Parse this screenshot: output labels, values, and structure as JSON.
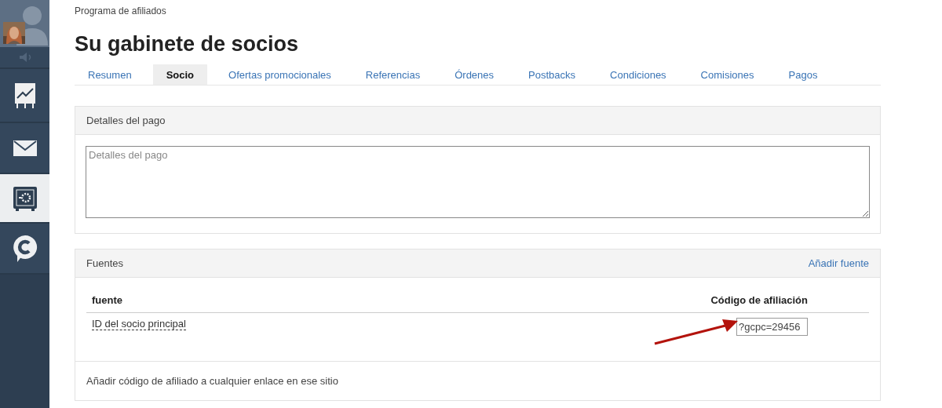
{
  "sidebar": {
    "items": [
      {
        "kind": "speaker",
        "selected": false
      },
      {
        "kind": "chart",
        "selected": false
      },
      {
        "kind": "mail",
        "selected": false
      },
      {
        "kind": "safe",
        "selected": true
      },
      {
        "kind": "chat",
        "selected": false
      }
    ]
  },
  "breadcrumb": "Programa de afiliados",
  "title": "Su gabinete de socios",
  "tabs": [
    {
      "label": "Resumen",
      "selected": false
    },
    {
      "label": "Socio",
      "selected": true
    },
    {
      "label": "Ofertas promocionales",
      "selected": false
    },
    {
      "label": "Referencias",
      "selected": false
    },
    {
      "label": "Órdenes",
      "selected": false
    },
    {
      "label": "Postbacks",
      "selected": false
    },
    {
      "label": "Condiciones",
      "selected": false
    },
    {
      "label": "Comisiones",
      "selected": false
    },
    {
      "label": "Pagos",
      "selected": false
    }
  ],
  "payment_panel": {
    "title": "Detalles del pago",
    "textarea": {
      "placeholder": "Detalles del pago"
    }
  },
  "sources_panel": {
    "title": "Fuentes",
    "action": "Añadir fuente",
    "table": {
      "columns": [
        "fuente",
        "Código de afiliación"
      ],
      "rows": [
        {
          "source": "ID del socio principal",
          "code": "?gcpc=29456"
        }
      ]
    },
    "footer": "Añadir código de afiliado a cualquier enlace en ese sitio"
  }
}
